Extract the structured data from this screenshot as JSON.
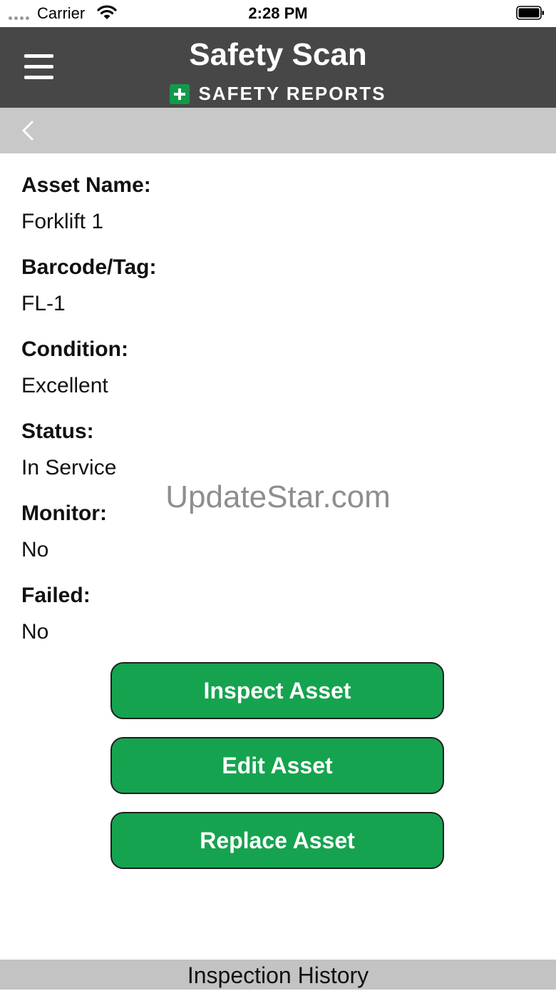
{
  "status_bar": {
    "carrier": "Carrier",
    "time": "2:28 PM"
  },
  "header": {
    "title": "Safety Scan",
    "brand": "SAFETY REPORTS",
    "background_color": "#474747",
    "brand_color": "#129a4a"
  },
  "nav": {
    "back_icon": "chevron-left-icon"
  },
  "fields": [
    {
      "label": "Asset Name:",
      "value": "Forklift 1"
    },
    {
      "label": "Barcode/Tag:",
      "value": "FL-1"
    },
    {
      "label": "Condition:",
      "value": "Excellent"
    },
    {
      "label": "Status:",
      "value": "In Service"
    },
    {
      "label": "Monitor:",
      "value": "No"
    },
    {
      "label": "Failed:",
      "value": "No"
    }
  ],
  "watermark": "UpdateStar.com",
  "buttons": {
    "inspect": "Inspect Asset",
    "edit": "Edit Asset",
    "replace": "Replace Asset",
    "color": "#16a34f"
  },
  "footer": {
    "label": "Inspection History"
  }
}
